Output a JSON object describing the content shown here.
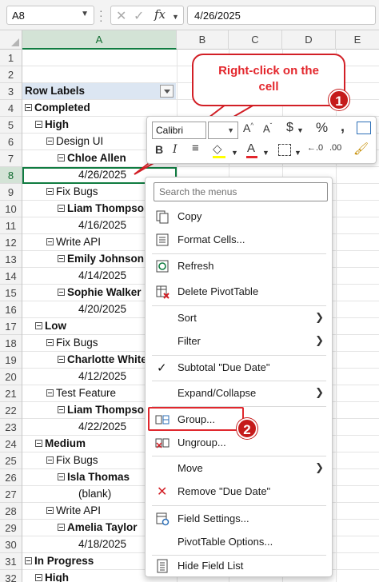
{
  "formula_bar": {
    "name_box": "A8",
    "fx_label": "fx",
    "formula": "4/26/2025"
  },
  "columns": [
    "A",
    "B",
    "C",
    "D",
    "E"
  ],
  "rows": [
    "1",
    "2",
    "3",
    "4",
    "5",
    "6",
    "7",
    "8",
    "9",
    "10",
    "11",
    "12",
    "13",
    "14",
    "15",
    "16",
    "17",
    "18",
    "19",
    "20",
    "21",
    "22",
    "23",
    "24",
    "25",
    "26",
    "27",
    "28",
    "29",
    "30",
    "31",
    "32"
  ],
  "cells": {
    "r3": "Row Labels",
    "r4": "Completed",
    "r5": "High",
    "r6": "Design UI",
    "r7": "Chloe Allen",
    "r8": "4/26/2025",
    "r9": "Fix Bugs",
    "r10": "Liam Thompson",
    "r11": "4/16/2025",
    "r12": "Write API",
    "r13": "Emily Johnson",
    "r14": "4/14/2025",
    "r15": "Sophie Walker",
    "r16": "4/20/2025",
    "r17": "Low",
    "r18": "Fix Bugs",
    "r19": "Charlotte White",
    "r20": "4/12/2025",
    "r21": "Test Feature",
    "r22": "Liam Thompson",
    "r23": "4/22/2025",
    "r24": "Medium",
    "r25": "Fix Bugs",
    "r26": "Isla Thomas",
    "r27": "(blank)",
    "r28": "Write API",
    "r29": "Amelia Taylor",
    "r30": "4/18/2025",
    "r31": "In Progress",
    "r32": "High"
  },
  "callout": {
    "text_line1": "Right-click on the",
    "text_line2": "cell",
    "badge1": "1",
    "badge2": "2"
  },
  "mini_toolbar": {
    "font": "Calibri",
    "size": "11"
  },
  "menu": {
    "search_placeholder": "Search the menus",
    "items": {
      "copy": "Copy",
      "format_cells": "Format Cells...",
      "refresh": "Refresh",
      "delete_pivot": "Delete PivotTable",
      "sort": "Sort",
      "filter": "Filter",
      "subtotal": "Subtotal \"Due Date\"",
      "expand_collapse": "Expand/Collapse",
      "group": "Group...",
      "ungroup": "Ungroup...",
      "move": "Move",
      "remove": "Remove \"Due Date\"",
      "field_settings": "Field Settings...",
      "pivot_options": "PivotTable Options...",
      "hide_field_list": "Hide Field List"
    }
  },
  "colors": {
    "accent_green": "#107c41",
    "callout_red": "#d21f26",
    "badge_red": "#c51b1b"
  }
}
